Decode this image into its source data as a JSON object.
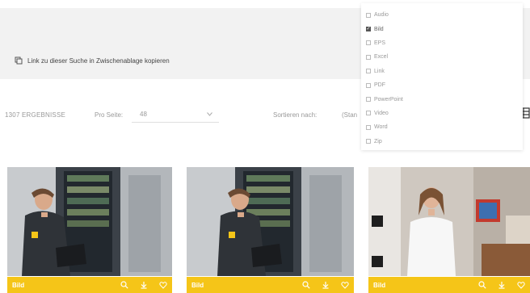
{
  "banner": {
    "copy_link_label": "Link zu dieser Suche in Zwischenablage kopieren"
  },
  "toolbar": {
    "results_label": "1307 ERGEBNISSE",
    "per_page_label": "Pro Seite:",
    "per_page_value": "48",
    "sort_label": "Sortieren nach:",
    "sort_value": "(Stan"
  },
  "filter_dropdown": {
    "items": [
      {
        "label": "Audio",
        "checked": false
      },
      {
        "label": "Bild",
        "checked": true
      },
      {
        "label": "EPS",
        "checked": false
      },
      {
        "label": "Excel",
        "checked": false
      },
      {
        "label": "Link",
        "checked": false
      },
      {
        "label": "PDF",
        "checked": false
      },
      {
        "label": "PowerPoint",
        "checked": false
      },
      {
        "label": "Video",
        "checked": false
      },
      {
        "label": "Word",
        "checked": false
      },
      {
        "label": "Zip",
        "checked": false
      }
    ]
  },
  "cards": [
    {
      "type_label": "Bild"
    },
    {
      "type_label": "Bild"
    },
    {
      "type_label": "Bild"
    }
  ],
  "colors": {
    "accent": "#f5c518",
    "banner_bg": "#f2f2f2"
  }
}
